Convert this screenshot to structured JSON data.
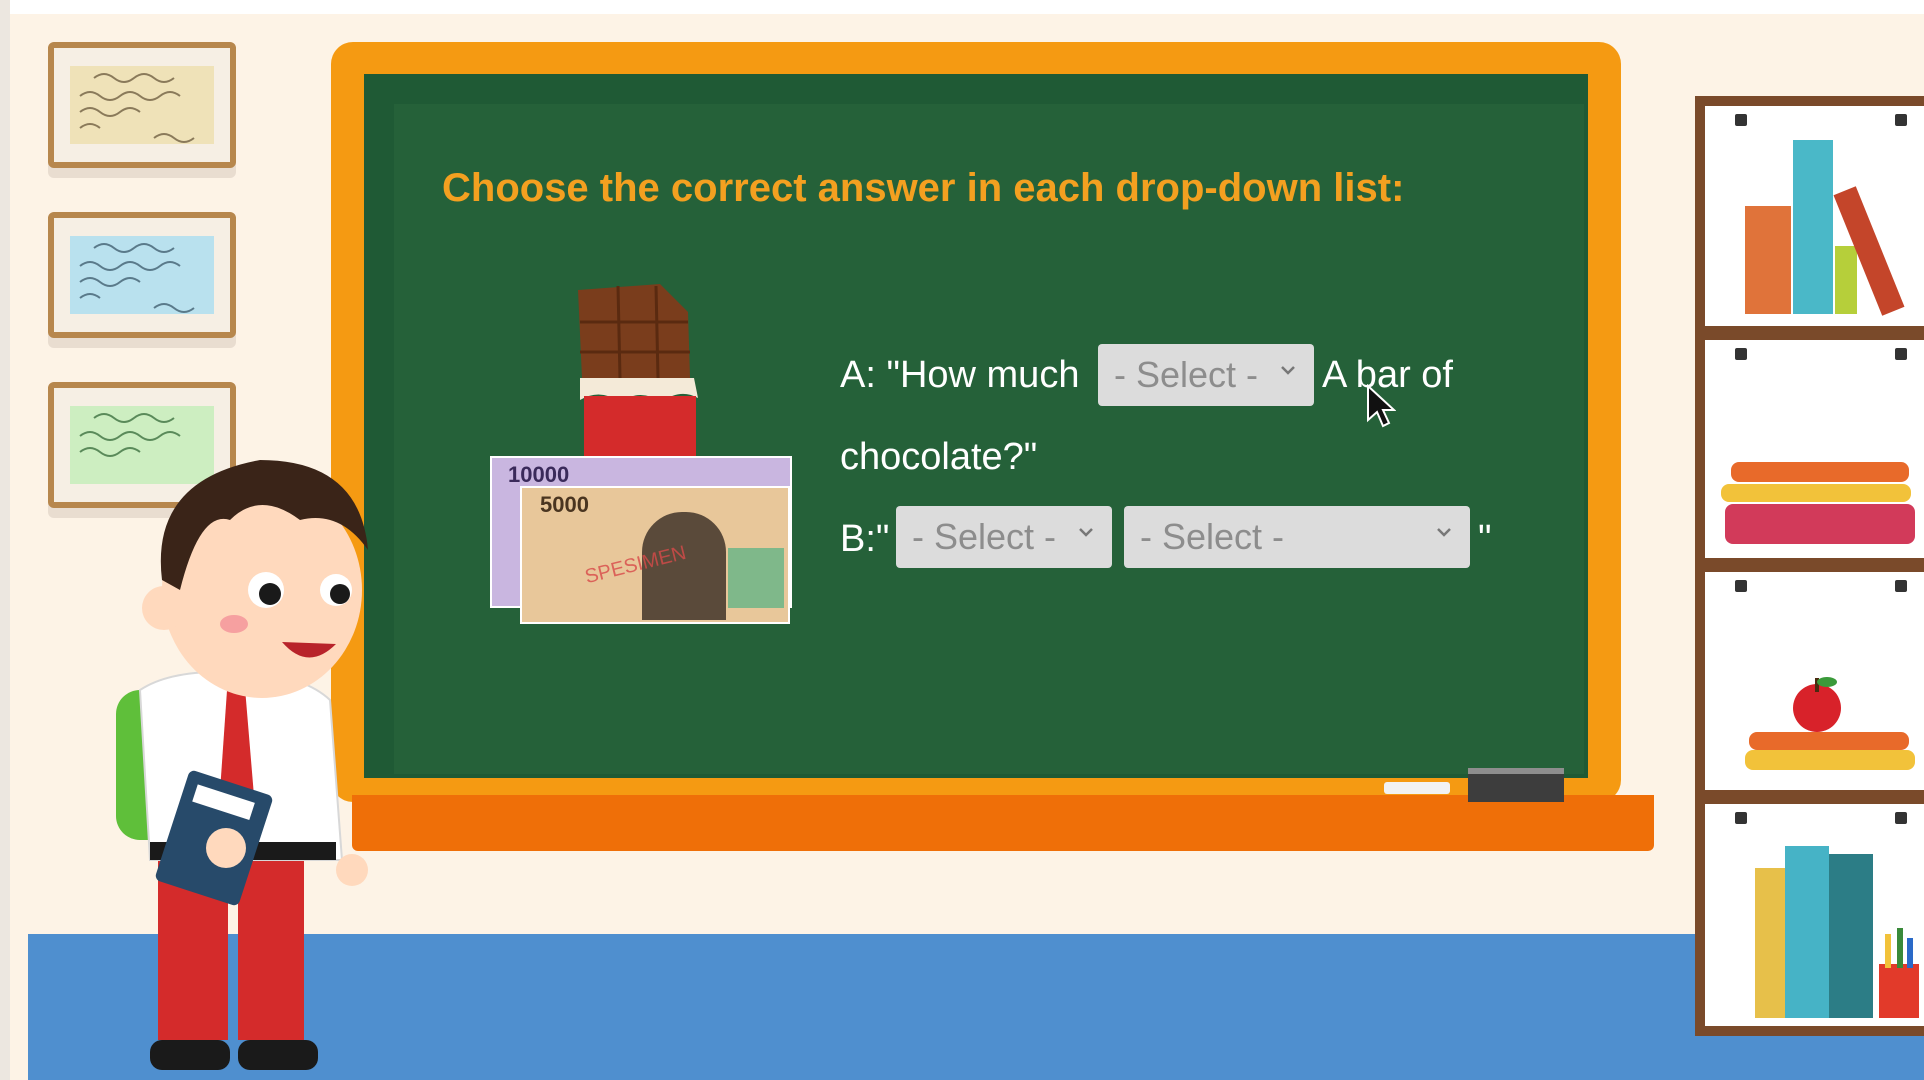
{
  "title": "Choose the correct answer in each drop-down list:",
  "question_a": {
    "prefix": "A: \"How much",
    "select_value": "- Select -",
    "suffix_1": "A bar of",
    "suffix_2": "chocolate?\""
  },
  "question_b": {
    "prefix": "B:\"",
    "select_1_value": "- Select -",
    "select_2_value": "- Select -",
    "suffix": "\""
  },
  "banknote": {
    "top_value": "10000",
    "front_value": "5000",
    "stamp": "SPESIMEN"
  },
  "colors": {
    "title": "#f3a020",
    "board": "#256139",
    "frame": "#f59a12",
    "ledge": "#ef6f08",
    "floor": "#4f8fcf"
  },
  "icons": [
    "chocolate-bar-icon",
    "banknote-icon",
    "chevron-down-icon",
    "apple-icon",
    "pencil-cup-icon",
    "mouse-cursor-icon"
  ]
}
